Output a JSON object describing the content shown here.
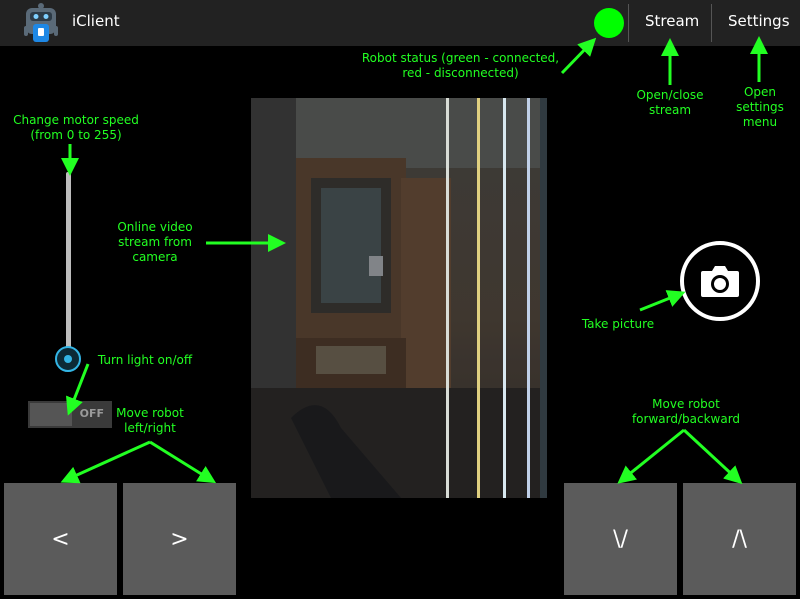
{
  "actionbar": {
    "title": "iClient",
    "stream_label": "Stream",
    "settings_label": "Settings",
    "status_color": "#00ff00"
  },
  "annotations": {
    "robot_status": [
      "Robot status (green - connected,",
      "red - disconnected)"
    ],
    "stream": [
      "Open/close",
      "stream"
    ],
    "settings": [
      "Open",
      "settings",
      "menu"
    ],
    "motor_speed": [
      "Change motor speed",
      "(from 0 to 255)"
    ],
    "video": [
      "Online video",
      "stream from",
      "camera"
    ],
    "light": [
      "Turn light on/off"
    ],
    "left_right": [
      "Move robot",
      "left/right"
    ],
    "take_picture": [
      "Take picture"
    ],
    "forward_backward": [
      "Move robot",
      "forward/backward"
    ]
  },
  "controls": {
    "speed_min": 0,
    "speed_max": 255,
    "speed_value": 0,
    "light_toggle_label": "OFF",
    "left_label": "<",
    "right_label": ">",
    "backward_label": "\\/",
    "forward_label": "/\\"
  },
  "colors": {
    "annotation": "#22ff22",
    "accent": "#33b5e5",
    "button": "#5b5b5b"
  }
}
